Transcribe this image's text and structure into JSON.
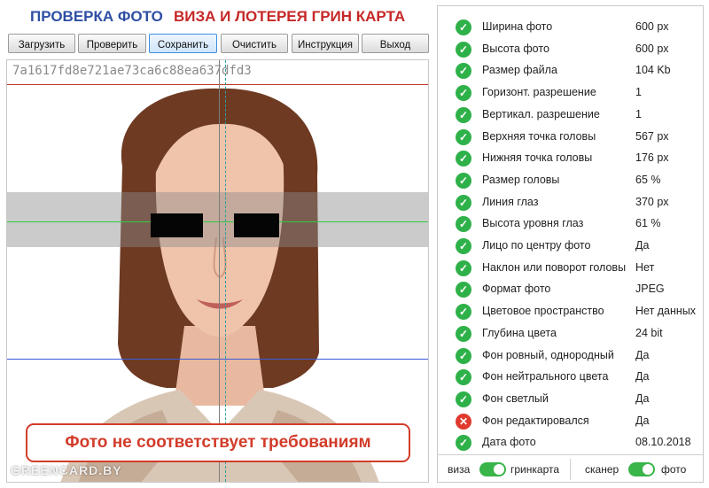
{
  "header": {
    "title_left": "ПРОВЕРКА ФОТО",
    "title_right": "ВИЗА И ЛОТЕРЕЯ ГРИН КАРТА"
  },
  "toolbar": {
    "upload": "Загрузить",
    "check": "Проверить",
    "save": "Сохранить",
    "clear": "Очистить",
    "manual": "Инструкция",
    "exit": "Выход"
  },
  "photo": {
    "hash": "7a1617fd8e721ae73ca6c88ea637dfd3",
    "status": "Фото не соответствует требованиям",
    "watermark": "GREENCARD.BY"
  },
  "checks": [
    {
      "label": "Ширина фото",
      "value": "600 px",
      "status": "ok"
    },
    {
      "label": "Высота фото",
      "value": "600 px",
      "status": "ok"
    },
    {
      "label": "Размер файла",
      "value": "104 Kb",
      "status": "ok"
    },
    {
      "label": "Горизонт. разрешение",
      "value": "1",
      "status": "ok"
    },
    {
      "label": "Вертикал. разрешение",
      "value": "1",
      "status": "ok"
    },
    {
      "label": "Верхняя точка головы",
      "value": "567 px",
      "status": "ok"
    },
    {
      "label": "Нижняя точка головы",
      "value": "176 px",
      "status": "ok"
    },
    {
      "label": "Размер головы",
      "value": "65 %",
      "status": "ok"
    },
    {
      "label": "Линия глаз",
      "value": "370 px",
      "status": "ok"
    },
    {
      "label": "Высота уровня глаз",
      "value": "61 %",
      "status": "ok"
    },
    {
      "label": "Лицо по центру фото",
      "value": "Да",
      "status": "ok"
    },
    {
      "label": "Наклон или поворот головы",
      "value": "Нет",
      "status": "ok"
    },
    {
      "label": "Формат фото",
      "value": "JPEG",
      "status": "ok"
    },
    {
      "label": "Цветовое пространство",
      "value": "Нет данных",
      "status": "ok"
    },
    {
      "label": "Глубина цвета",
      "value": "24 bit",
      "status": "ok"
    },
    {
      "label": "Фон ровный, однородный",
      "value": "Да",
      "status": "ok"
    },
    {
      "label": "Фон нейтрального цвета",
      "value": "Да",
      "status": "ok"
    },
    {
      "label": "Фон светлый",
      "value": "Да",
      "status": "ok"
    },
    {
      "label": "Фон редактировался",
      "value": "Да",
      "status": "error"
    },
    {
      "label": "Дата фото",
      "value": "08.10.2018",
      "status": "ok"
    }
  ],
  "footer": {
    "toggle1_left": "виза",
    "toggle1_right": "гринкарта",
    "toggle2_left": "сканер",
    "toggle2_right": "фото"
  },
  "colors": {
    "ok": "#2fb14a",
    "error": "#e03a2e",
    "title_blue": "#2e4fa3",
    "title_red": "#c62828",
    "top_line": "#c0392b",
    "eye_line": "#2ecc40",
    "chin_line": "#3b5bdb",
    "center_line": "#2aa0a0",
    "toggle": "#39b54a"
  }
}
